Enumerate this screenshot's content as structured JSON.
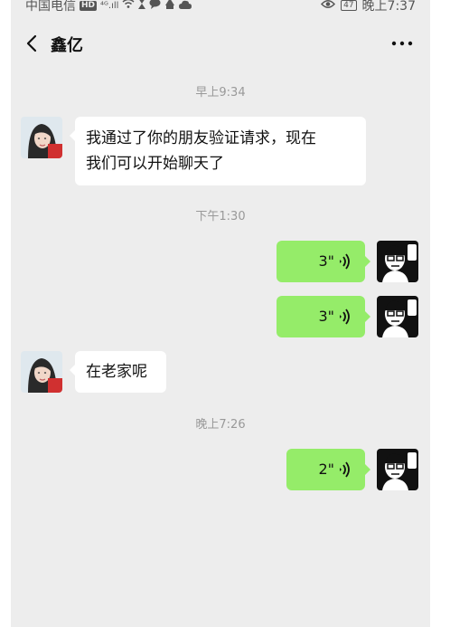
{
  "status_bar": {
    "carrier": "中国电信",
    "hd": "HD",
    "signal": "⁴ᴳ.ıll",
    "battery": "47",
    "time": "晚上7:37"
  },
  "header": {
    "title": "鑫亿",
    "more_label": "···"
  },
  "messages": [
    {
      "kind": "time",
      "text": "早上9:34"
    },
    {
      "kind": "text",
      "from": "contact",
      "line1": "我通过了你的朋友验证请求，现在",
      "line2": "我们可以开始聊天了"
    },
    {
      "kind": "time",
      "text": "下午1:30"
    },
    {
      "kind": "voice",
      "from": "me",
      "duration": "3\""
    },
    {
      "kind": "voice",
      "from": "me",
      "duration": "3\""
    },
    {
      "kind": "text",
      "from": "contact",
      "line1": "在老家呢"
    },
    {
      "kind": "time",
      "text": "晚上7:26"
    },
    {
      "kind": "voice",
      "from": "me",
      "duration": "2\""
    }
  ],
  "colors": {
    "background": "#ededed",
    "voice_bubble": "#95ec69",
    "text_bubble": "#ffffff"
  }
}
